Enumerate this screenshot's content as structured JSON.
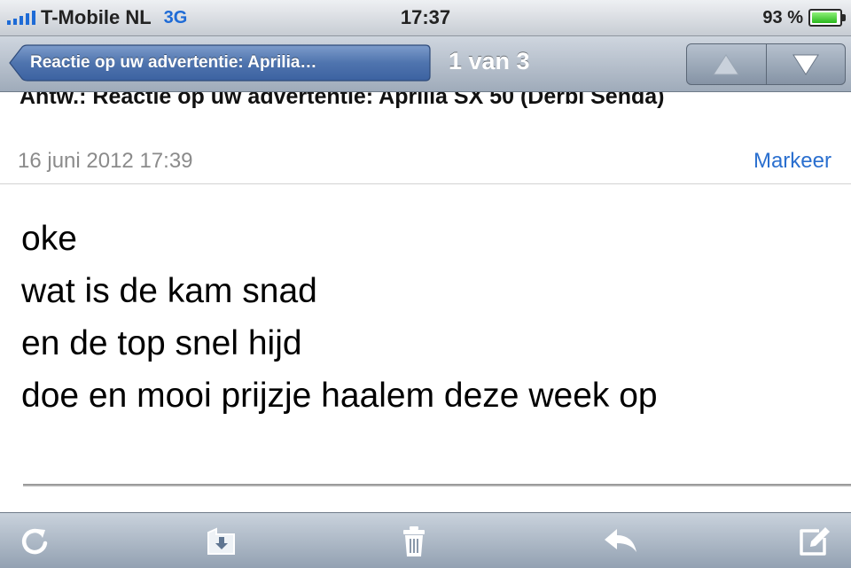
{
  "status_bar": {
    "carrier": "T-Mobile NL",
    "network": "3G",
    "time": "17:37",
    "battery_percent": "93 %",
    "battery_level": 0.93,
    "signal_bars": 5
  },
  "nav": {
    "back_label": "Reactie op uw advertentie: Aprilia…",
    "counter": "1 van 3",
    "prev_icon": "up-triangle-icon",
    "next_icon": "down-triangle-icon"
  },
  "message": {
    "subject": "Antw.: Reactie op uw advertentie: Aprilia SX 50 (Derbi Senda)",
    "date": "16 juni 2012 17:39",
    "mark_label": "Markeer",
    "body_lines": [
      "oke",
      "wat is de kam snad",
      "en de top snel hijd",
      "doe en mooi prijzje haalem deze week op"
    ]
  },
  "toolbar": {
    "items": [
      "refresh-icon",
      "move-folder-icon",
      "trash-icon",
      "reply-icon",
      "compose-icon"
    ]
  },
  "colors": {
    "accent_blue": "#2a6fcf",
    "nav_gradient_top": "#cfd6df",
    "nav_gradient_bottom": "#9fabba"
  }
}
